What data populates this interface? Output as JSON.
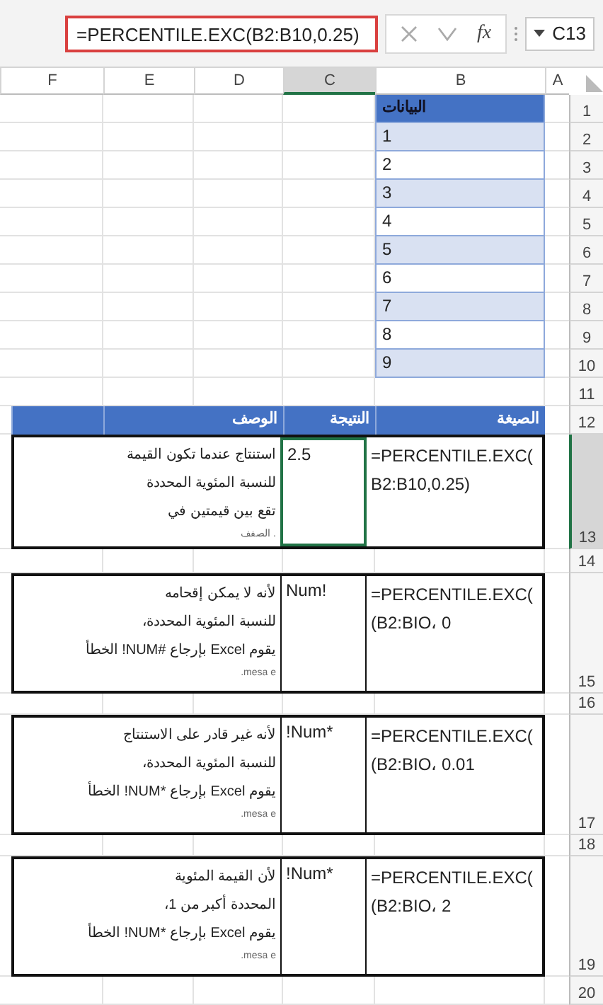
{
  "formula_bar": {
    "name_box": "C13",
    "function_label": "fx",
    "formula": "=PERCENTILE.EXC(B2:B10,0.25)"
  },
  "columns": [
    {
      "label": "A",
      "selected": false
    },
    {
      "label": "B",
      "selected": false
    },
    {
      "label": "C",
      "selected": true
    },
    {
      "label": "D",
      "selected": false
    },
    {
      "label": "E",
      "selected": false
    },
    {
      "label": "F",
      "selected": false
    }
  ],
  "rows": [
    {
      "label": "1",
      "selected": false
    },
    {
      "label": "2",
      "selected": false
    },
    {
      "label": "3",
      "selected": false
    },
    {
      "label": "4",
      "selected": false
    },
    {
      "label": "5",
      "selected": false
    },
    {
      "label": "6",
      "selected": false
    },
    {
      "label": "7",
      "selected": false
    },
    {
      "label": "8",
      "selected": false
    },
    {
      "label": "9",
      "selected": false
    },
    {
      "label": "10",
      "selected": false
    },
    {
      "label": "11",
      "selected": false
    },
    {
      "label": "12",
      "selected": false
    },
    {
      "label": "13",
      "selected": true
    },
    {
      "label": "14",
      "selected": false
    },
    {
      "label": "15",
      "selected": false
    },
    {
      "label": "16",
      "selected": false
    },
    {
      "label": "17",
      "selected": false
    },
    {
      "label": "18",
      "selected": false
    },
    {
      "label": "19",
      "selected": false
    },
    {
      "label": "20",
      "selected": false
    }
  ],
  "data_table": {
    "header": "البيانات",
    "values": [
      "1",
      "2",
      "3",
      "4",
      "5",
      "6",
      "7",
      "8",
      "9"
    ]
  },
  "examples_table": {
    "headers": [
      "الصيغة",
      "النتيجة",
      "الوصف"
    ],
    "rows": [
      {
        "formula": [
          "=PERCENTILE.EXC(",
          "B2:B10,0.25)"
        ],
        "result": "2.5",
        "description": [
          "استنتاج عندما تكون القيمة",
          "للنسبة المئوية المحددة",
          "تقع بين قيمتين في"
        ],
        "note": "الصفف .",
        "selected": true
      },
      {
        "formula": [
          "=PERCENTILE.EXC(",
          "(B2:BIO، 0"
        ],
        "result": "Num!",
        "description": [
          "لأنه لا يمكن إقحامه",
          "للنسبة المئوية المحددة،",
          "يقوم Excel بإرجاع #NUM! الخطأ"
        ],
        "note": ".mesa e",
        "selected": false
      },
      {
        "formula": [
          "=PERCENTILE.EXC(",
          "(B2:BIO، 0.01"
        ],
        "result": "!Num*",
        "description": [
          "لأنه غير قادر على الاستنتاج",
          "للنسبة المئوية المحددة،",
          "يقوم Excel بإرجاع *NUM! الخطأ"
        ],
        "note": ".mesa e",
        "selected": false
      },
      {
        "formula": [
          "=PERCENTILE.EXC(",
          "(B2:BIO، 2"
        ],
        "result": "!Num*",
        "description": [
          "لأن القيمة المئوية",
          "المحددة أكبر من 1،",
          "يقوم Excel بإرجاع *NUM! الخطأ"
        ],
        "note": ".mesa e",
        "selected": false
      }
    ]
  }
}
